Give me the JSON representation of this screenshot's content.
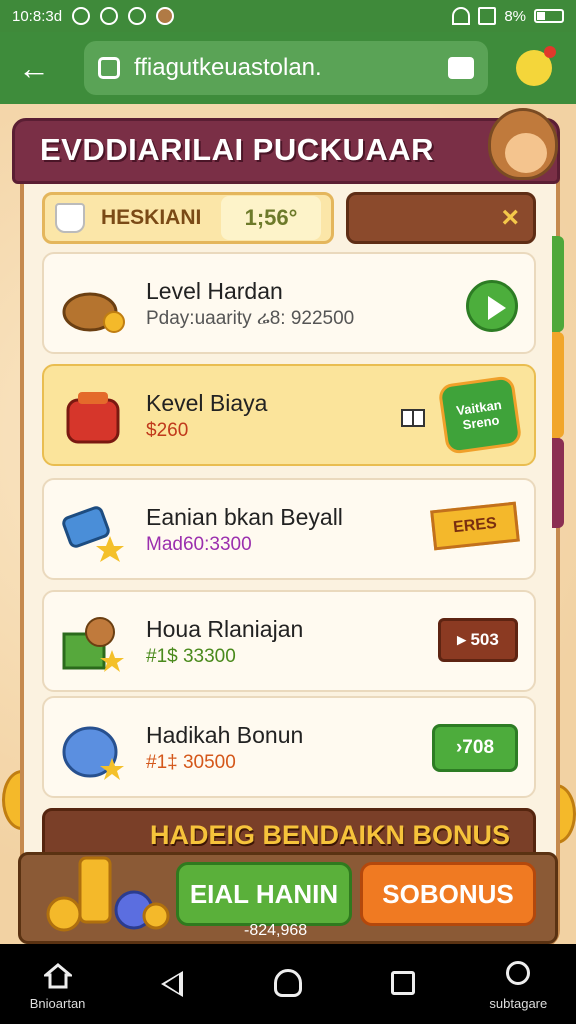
{
  "status_bar": {
    "time": "10:8:3d",
    "battery": "8%"
  },
  "browser": {
    "url": "ffiagutkeuastolan."
  },
  "panel": {
    "title": "EVDDIARILAI PUCKUAAR",
    "search": {
      "label": "HESKIANI",
      "value": "1;56°"
    },
    "close_label": "×"
  },
  "rows": [
    {
      "title": "Level Hardan",
      "subtitle": "Pday:uaarity ሬ8: 922500",
      "subtitle_color": "#555555",
      "action_type": "play"
    },
    {
      "title": "Kevel Biaya",
      "subtitle": "$260",
      "subtitle_color": "#c0391b",
      "action_type": "badge-burst",
      "action_label": "Vaitkan Sreno",
      "extra_icon": "gift-icon"
    },
    {
      "title": "Eanian bkan Beyall",
      "subtitle": "Mad60:3300",
      "subtitle_color": "#9b2fae",
      "action_type": "ribbon",
      "action_label": "ERES"
    },
    {
      "title": "Houa Rlaniajan",
      "subtitle": "#1$ 33300",
      "subtitle_color": "#4a8a1c",
      "action_type": "sign",
      "action_label": "▸ 503"
    },
    {
      "title": "Hadikah Bonun",
      "subtitle": "#1‡ 30500",
      "subtitle_color": "#d4571a",
      "action_type": "green",
      "action_label": "›708"
    }
  ],
  "bonus": {
    "title": "HADEIG BENDAIKN BONUS",
    "primary_label": "EIAL HANIN",
    "primary_sub": "-824,968",
    "secondary_label": "SOBONUS"
  },
  "nav": {
    "home_label": "Bnioartan",
    "profile_label": "subtagare"
  },
  "colors": {
    "brand_green": "#3e8c3b",
    "title_maroon": "#7a2f46",
    "gold": "#f6c33b"
  }
}
